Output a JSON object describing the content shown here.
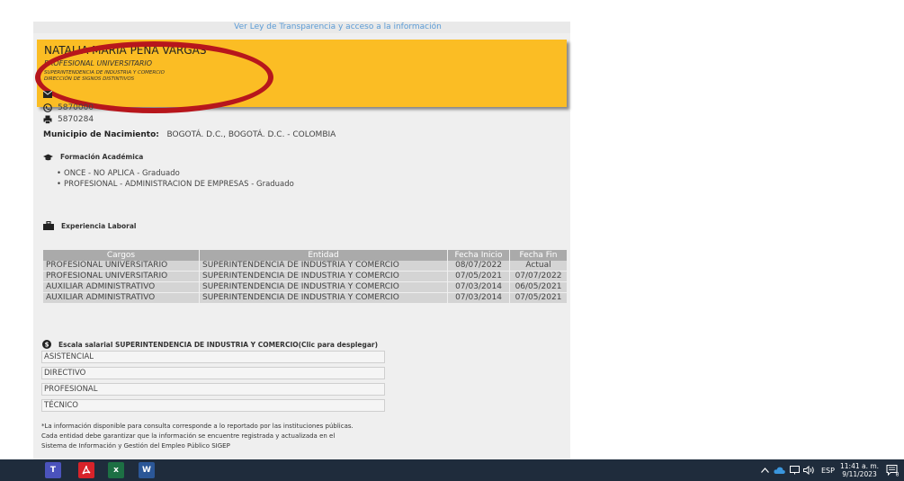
{
  "top_link": "Ver Ley de Transparencia y acceso a la información",
  "header": {
    "name": "NATALIA MARIA PEÑA VARGAS",
    "role": "PROFESIONAL UNIVERSITARIO",
    "entity": "SUPERINTENDENCIA DE INDUSTRIA Y COMERCIO",
    "dependency": "DIRECCIÓN DE SIGNOS DISTINTIVOS"
  },
  "contact": {
    "phone": "5870000",
    "fax": "5870284"
  },
  "municipio": {
    "label": "Municipio de Nacimiento:",
    "value": "BOGOTÁ. D.C., BOGOTÁ. D.C. - COLOMBIA"
  },
  "education": {
    "title": "Formación Académica",
    "items": [
      "ONCE - NO APLICA - Graduado",
      "PROFESIONAL - ADMINISTRACION DE EMPRESAS - Graduado"
    ]
  },
  "experience": {
    "title": "Experiencia Laboral",
    "headers": [
      "Cargos",
      "Entidad",
      "Fecha Inicio",
      "Fecha Fin"
    ],
    "rows": [
      [
        "PROFESIONAL UNIVERSITARIO",
        "SUPERINTENDENCIA DE INDUSTRIA Y COMERCIO",
        "08/07/2022",
        "Actual"
      ],
      [
        "PROFESIONAL UNIVERSITARIO",
        "SUPERINTENDENCIA DE INDUSTRIA Y COMERCIO",
        "07/05/2021",
        "07/07/2022"
      ],
      [
        "AUXILIAR ADMINISTRATIVO",
        "SUPERINTENDENCIA DE INDUSTRIA Y COMERCIO",
        "07/03/2014",
        "06/05/2021"
      ],
      [
        "AUXILIAR ADMINISTRATIVO",
        "SUPERINTENDENCIA DE INDUSTRIA Y COMERCIO",
        "07/03/2014",
        "07/05/2021"
      ]
    ]
  },
  "salary": {
    "title": "Escala salarial SUPERINTENDENCIA DE INDUSTRIA Y COMERCIO(Clic para desplegar)",
    "items": [
      "ASISTENCIAL",
      "DIRECTIVO",
      "PROFESIONAL",
      "TÉCNICO"
    ]
  },
  "footnote": {
    "line1": "*La información disponible para consulta corresponde a lo reportado por las instituciones públicas.",
    "line2": "Cada entidad debe garantizar que la información se encuentre registrada y actualizada en el",
    "line3": "Sistema de Información y Gestión del Empleo Público SIGEP"
  },
  "taskbar": {
    "language": "ESP",
    "time": "11:41 a. m.",
    "date": "9/11/2023",
    "notification_count": "8",
    "apps": [
      "teams-icon",
      "acrobat-icon",
      "excel-icon",
      "word-icon"
    ]
  },
  "colors": {
    "header_bg": "#fbbd24",
    "highlight_ellipse": "#b7161c",
    "link": "#5b9bd5",
    "taskbar": "#1f2c3c"
  }
}
